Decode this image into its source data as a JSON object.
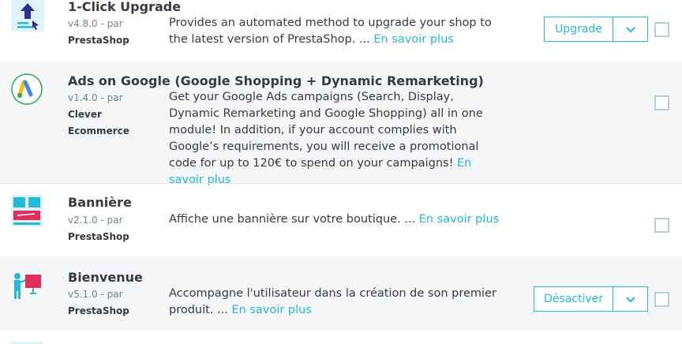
{
  "modules": [
    {
      "title": "1-Click Upgrade",
      "version": "v4.8.0 - par",
      "author": "PrestaShop",
      "description": "Provides an automated method to upgrade your shop to the latest version of PrestaShop. ...",
      "more": "En savoir plus",
      "action": "Upgrade",
      "logo_icon": "upgrade-arrow-icon"
    },
    {
      "title": "Ads on Google (Google Shopping + Dynamic Remarketing)",
      "version": "v1.4.0 - par",
      "author_line1": "Clever",
      "author_line2": "Ecommerce",
      "description": "Get your Google Ads campaigns (Search, Display, Dynamic Remarketing and Google Shopping) all in one module! In addition, if your account complies with Google’s requirements, you will receive a promotional code for up to 120€ to spend on your campaigns!",
      "more": "En savoir plus",
      "logo_icon": "google-ads-icon"
    },
    {
      "title": "Bannière",
      "version": "v2.1.0 - par",
      "author": "PrestaShop",
      "description": "Affiche une bannière sur votre boutique. ...",
      "more": "En savoir plus",
      "logo_icon": "banner-icon"
    },
    {
      "title": "Bienvenue",
      "version": "v5.1.0 - par",
      "author": "PrestaShop",
      "description": "Accompagne l'utilisateur dans la création de son premier produit. ...",
      "more": "En savoir plus",
      "action": "Désactiver",
      "logo_icon": "welcome-presenter-icon"
    }
  ],
  "colors": {
    "accent": "#25b9d7",
    "row_alt": "#f4f6f7",
    "text": "#363a41",
    "meta": "#6c868e"
  }
}
